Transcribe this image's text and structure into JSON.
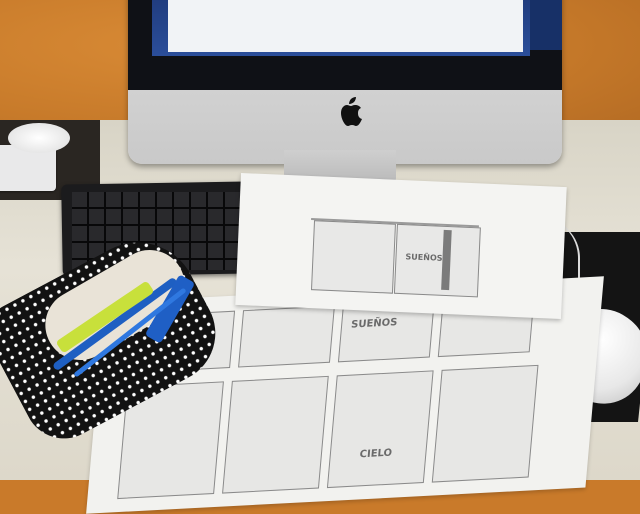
{
  "scene": {
    "monitor_logo": "apple-logo",
    "sketch_texts": [
      {
        "id": "top-bubble",
        "text": "SUEÑOS"
      },
      {
        "id": "bottom-bubble",
        "text": "SUEÑOS"
      },
      {
        "id": "bottom-ciel",
        "text": "CIELO"
      }
    ],
    "colors": {
      "wall": "#c97a2a",
      "desk": "#e2ddd0",
      "monitor": "#d0d0d0",
      "keyboard": "#1b1b1d",
      "paper": "#f3f3f0",
      "pencil_case": "#121212"
    }
  }
}
